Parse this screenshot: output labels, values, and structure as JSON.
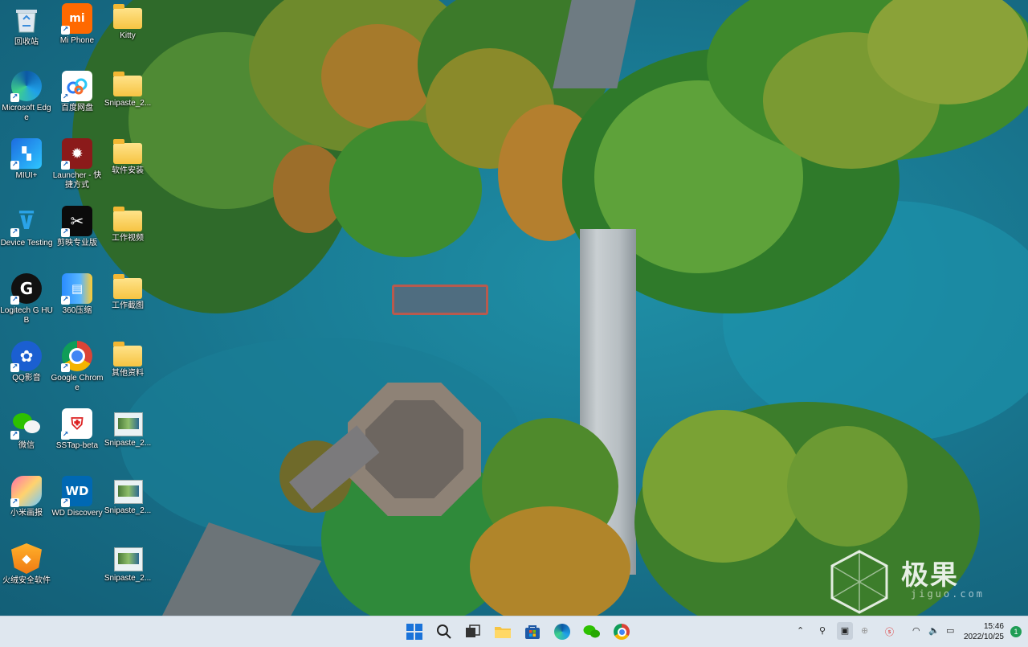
{
  "desktop": {
    "icons": [
      {
        "label": "回收站",
        "icon": "recycle-bin-icon"
      },
      {
        "label": "Mi Phone",
        "icon": "mi-logo-icon"
      },
      {
        "label": "Kitty",
        "icon": "folder-icon"
      },
      {
        "label": "Microsoft Edge",
        "icon": "edge-icon"
      },
      {
        "label": "百度网盘",
        "icon": "baidu-netdisk-icon"
      },
      {
        "label": "Snipaste_2...",
        "icon": "folder-icon"
      },
      {
        "label": "MIUI+",
        "icon": "miui-plus-icon"
      },
      {
        "label": "Launcher - 快捷方式",
        "icon": "launcher-icon"
      },
      {
        "label": "软件安装",
        "icon": "folder-icon"
      },
      {
        "label": "Device Testing",
        "icon": "device-testing-icon"
      },
      {
        "label": "剪映专业版",
        "icon": "capcut-icon"
      },
      {
        "label": "工作视频",
        "icon": "folder-icon"
      },
      {
        "label": "Logitech G HUB",
        "icon": "logitech-g-hub-icon"
      },
      {
        "label": "360压缩",
        "icon": "360-zip-icon"
      },
      {
        "label": "工作截图",
        "icon": "folder-icon"
      },
      {
        "label": "QQ影音",
        "icon": "qq-player-icon"
      },
      {
        "label": "Google Chrome",
        "icon": "chrome-icon"
      },
      {
        "label": "其他资料",
        "icon": "folder-icon"
      },
      {
        "label": "微信",
        "icon": "wechat-icon"
      },
      {
        "label": "SSTap-beta",
        "icon": "sstap-icon"
      },
      {
        "label": "Snipaste_2...",
        "icon": "image-file-icon"
      },
      {
        "label": "小米画报",
        "icon": "mi-wallpaper-icon"
      },
      {
        "label": "WD Discovery",
        "icon": "wd-discovery-icon"
      },
      {
        "label": "Snipaste_2...",
        "icon": "image-file-icon"
      },
      {
        "label": "火绒安全软件",
        "icon": "huorong-security-icon"
      },
      {
        "label": "Snipaste_2...",
        "icon": "image-file-icon"
      }
    ]
  },
  "watermark": {
    "text": "极果",
    "sub": "jiguo.com"
  },
  "taskbar": {
    "pinned": [
      {
        "name": "start-button",
        "icon": "windows-logo-icon"
      },
      {
        "name": "search-button",
        "icon": "search-icon"
      },
      {
        "name": "task-view-button",
        "icon": "task-view-icon"
      },
      {
        "name": "file-explorer-button",
        "icon": "folder-icon"
      },
      {
        "name": "store-button",
        "icon": "store-icon"
      },
      {
        "name": "edge-taskbar-button",
        "icon": "edge-icon"
      },
      {
        "name": "wechat-taskbar-button",
        "icon": "wechat-icon"
      },
      {
        "name": "chrome-taskbar-button",
        "icon": "chrome-icon"
      }
    ],
    "tray": {
      "time": "15:46",
      "date": "2022/10/25",
      "icons": [
        "chevron-up-icon",
        "usb-icon",
        "app-icon",
        "network-icon",
        "ime-icon",
        "wifi-icon",
        "volume-icon",
        "battery-icon"
      ]
    },
    "notification_badge": "1"
  },
  "colors": {
    "taskbar_bg": "#dfe7ef",
    "water": "#1a7e97"
  }
}
